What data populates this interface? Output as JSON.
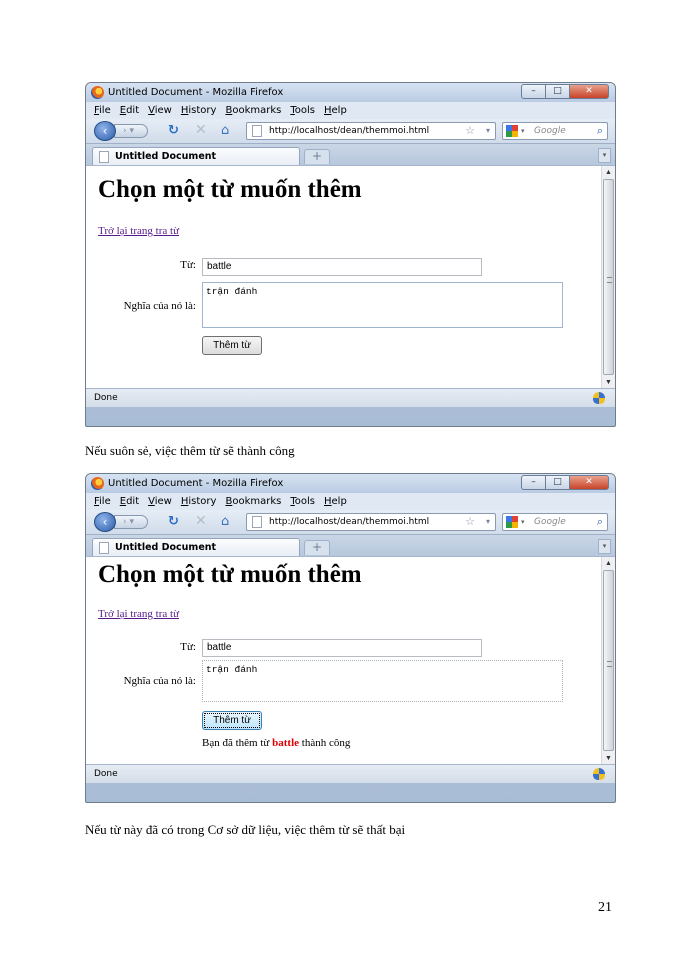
{
  "browser": {
    "window_title": "Untitled Document - Mozilla Firefox",
    "menu": [
      "File",
      "Edit",
      "View",
      "History",
      "Bookmarks",
      "Tools",
      "Help"
    ],
    "url": "http://localhost/dean/themmoi.html",
    "search_placeholder": "Google",
    "tab_title": "Untitled Document",
    "new_tab_symbol": "+",
    "status": "Done"
  },
  "page": {
    "heading": "Chọn một từ muốn thêm",
    "back_link": "Trở lại trang tra từ",
    "word_label": "Từ:",
    "meaning_label": "Nghĩa của nó là:",
    "add_button": "Thêm từ"
  },
  "screenshot1": {
    "word_value": "battle",
    "meaning_value": "trận đánh"
  },
  "screenshot2": {
    "word_value": "battle",
    "meaning_value": "trận đánh",
    "result_prefix": "Bạn đã thêm từ ",
    "result_word": "battle",
    "result_suffix": " thành công"
  },
  "captions": {
    "success": "Nếu suôn sẻ, việc thêm từ sẽ thành  công",
    "failure": "Nếu từ này đã có trong Cơ sở dữ liệu, việc thêm từ sẽ thất bại"
  },
  "page_number": "21"
}
